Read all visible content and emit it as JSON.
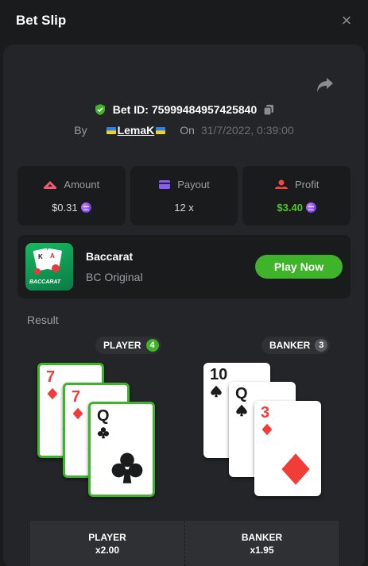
{
  "header": {
    "title": "Bet Slip",
    "close_symbol": "×"
  },
  "bet": {
    "id_label": "Bet ID:",
    "id_value": "75999484957425840",
    "by_label": "By",
    "user": "LemaK",
    "on_label": "On",
    "date": "31/7/2022, 0:39:00"
  },
  "stats": {
    "amount": {
      "label": "Amount",
      "value": "$0.31"
    },
    "payout": {
      "label": "Payout",
      "value": "12 x"
    },
    "profit": {
      "label": "Profit",
      "value": "$3.40"
    }
  },
  "game": {
    "name": "Baccarat",
    "subtitle": "BC Original",
    "button": "Play Now",
    "icon_text": "BACCARAT"
  },
  "result": {
    "label": "Result",
    "player": {
      "label": "PLAYER",
      "score": "4"
    },
    "banker": {
      "label": "BANKER",
      "score": "3"
    },
    "player_cards": [
      {
        "rank": "7",
        "suit": "diamond"
      },
      {
        "rank": "7",
        "suit": "diamond"
      },
      {
        "rank": "Q",
        "suit": "club"
      }
    ],
    "banker_cards": [
      {
        "rank": "10",
        "suit": "spade"
      },
      {
        "rank": "Q",
        "suit": "spade"
      },
      {
        "rank": "3",
        "suit": "diamond"
      }
    ]
  },
  "bottom": {
    "player": {
      "label": "PLAYER",
      "odds": "x2.00"
    },
    "banker": {
      "label": "BANKER",
      "odds": "x1.95"
    }
  },
  "colors": {
    "accent_green": "#3fb32a",
    "profit_green": "#51c42b",
    "panel": "#232528",
    "background": "#1a1b1d"
  }
}
